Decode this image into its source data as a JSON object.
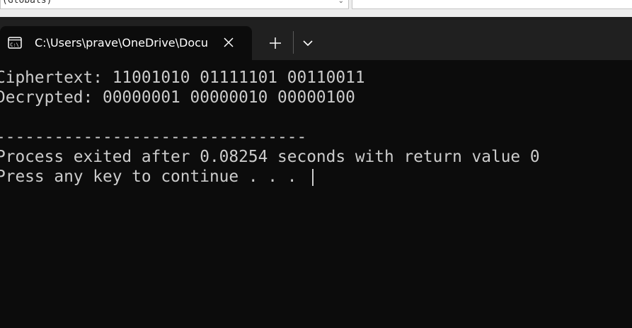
{
  "ide": {
    "scope_combo_text": "(Globals)"
  },
  "tab": {
    "title": "C:\\Users\\prave\\OneDrive\\Documents",
    "icon": "console-app-icon",
    "close_icon": "close-icon"
  },
  "titlebar": {
    "new_tab_icon": "plus-icon",
    "dropdown_icon": "chevron-down-icon"
  },
  "console": {
    "lines": [
      "Ciphertext: 11001010 01111101 00110011",
      "Decrypted: 00000001 00000010 00000100",
      "",
      "--------------------------------",
      "Process exited after 0.08254 seconds with return value 0",
      "Press any key to continue . . . "
    ]
  },
  "colors": {
    "console_bg": "#0c0c0c",
    "console_fg": "#cccccc",
    "titlebar_bg": "#202020",
    "tab_text": "#ffffff"
  }
}
